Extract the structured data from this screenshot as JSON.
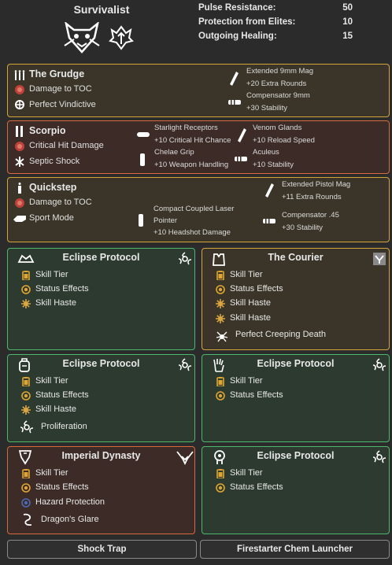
{
  "header": {
    "title": "Survivalist",
    "stats": [
      {
        "name": "Pulse Resistance:",
        "value": "50"
      },
      {
        "name": "Protection from Elites:",
        "value": "10"
      },
      {
        "name": "Outgoing Healing:",
        "value": "15"
      }
    ]
  },
  "weapons": [
    {
      "name": "The Grudge",
      "lines": [
        "Damage to TOC",
        "Perfect Vindictive"
      ],
      "mods": [
        {
          "name": "Extended 9mm Mag",
          "bonus": "+20  Extra Rounds"
        },
        {
          "name": "Compensator 9mm",
          "bonus": "+30  Stability"
        }
      ]
    },
    {
      "name": "Scorpio",
      "lines": [
        "Critical Hit Damage",
        "Septic Shock"
      ],
      "mods": [
        {
          "name": "Starlight Receptors",
          "bonus": "+10  Critical Hit Chance"
        },
        {
          "name": "Venom Glands",
          "bonus": "+10  Reload Speed"
        },
        {
          "name": "Chelae Grip",
          "bonus": "+10  Weapon Handling"
        },
        {
          "name": "Aculeus",
          "bonus": "+10  Stability"
        }
      ]
    },
    {
      "name": "Quickstep",
      "lines": [
        "Damage to TOC",
        "Sport Mode"
      ],
      "mods": [
        {
          "name": "Compact Coupled Laser",
          "name2": "Pointer",
          "bonus": "+10  Headshot Damage"
        },
        {
          "name": "Extended Pistol Mag",
          "bonus": "+11  Extra Rounds"
        },
        {
          "name": "Compensator .45",
          "bonus": "+30  Stability"
        }
      ]
    }
  ],
  "gear": [
    {
      "name": "Eclipse Protocol",
      "attrs": [
        "Skill Tier",
        "Status Effects",
        "Skill Haste"
      ],
      "talent": ""
    },
    {
      "name": "The Courier",
      "attrs": [
        "Skill Tier",
        "Status Effects",
        "Skill Haste",
        "Skill Haste"
      ],
      "talent": "Perfect Creeping Death"
    },
    {
      "name": "Eclipse Protocol",
      "attrs": [
        "Skill Tier",
        "Status Effects",
        "Skill Haste"
      ],
      "talent": "Proliferation"
    },
    {
      "name": "Eclipse Protocol",
      "attrs": [
        "Skill Tier",
        "Status Effects"
      ],
      "talent": ""
    },
    {
      "name": "Imperial Dynasty",
      "attrs": [
        "Skill Tier",
        "Status Effects",
        "Hazard Protection"
      ],
      "talent": "Dragon's Glare"
    },
    {
      "name": "Eclipse Protocol",
      "attrs": [
        "Skill Tier",
        "Status Effects"
      ],
      "talent": ""
    }
  ],
  "buttons": {
    "left": "Shock Trap",
    "right": "Firestarter Chem Launcher"
  },
  "colors": {
    "exotic": "#d5a53a",
    "named": "#d56a3a",
    "gearset": "#4bb86c",
    "skill": "#e0a530",
    "haste": "#d9a640",
    "hazard": "#4a6ab8"
  }
}
